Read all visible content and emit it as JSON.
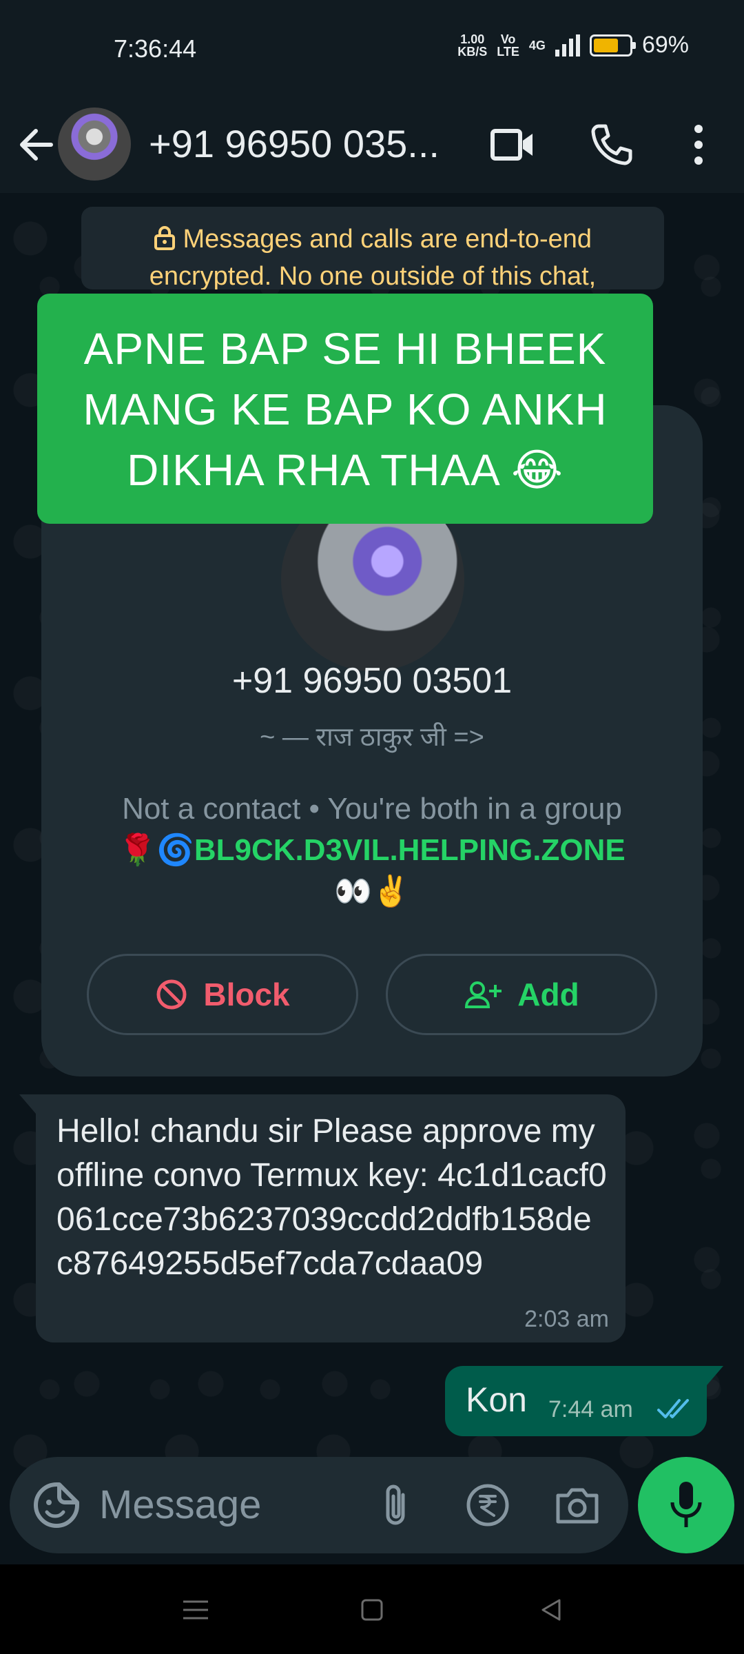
{
  "status_bar": {
    "time": "7:36:44",
    "speed_value": "1.00",
    "speed_unit": "KB/S",
    "volte_top": "Vo",
    "volte_bottom": "LTE",
    "network": "4G",
    "battery_percent": "69%",
    "battery_level": 0.69,
    "battery_color": "#f0b400"
  },
  "header": {
    "title": "+91 96950 035...",
    "icons": [
      "back-arrow-icon",
      "video-call-icon",
      "phone-icon",
      "more-options-icon"
    ]
  },
  "encryption_notice": "Messages and calls are end-to-end encrypted. No one outside of this chat,",
  "overlay_banner": {
    "text": "APNE BAP SE HI BHEEK MANG KE BAP KO ANKH DIKHA RHA THAA 😂",
    "color": "#23b14d"
  },
  "contact_card": {
    "phone": "+91 96950 03501",
    "about": "~ — राज ठाकुर जी =>",
    "info": "Not a contact • You're both in a group",
    "group_prefix": "🌹🌀",
    "group_name": "BL9CK.D3VIL.HELPING.ZONE",
    "group_suffix": "👀✌️",
    "block_label": "Block",
    "add_label": "Add"
  },
  "messages": [
    {
      "direction": "incoming",
      "text": "Hello! chandu sir Please approve my offline convo Termux key: 4c1d1cacf0061cce73b6237039ccdd2ddfb158dec87649255d5ef7cda7cdaa09",
      "time": "2:03 am"
    },
    {
      "direction": "outgoing",
      "text": "Kon",
      "time": "7:44 am",
      "status": "read"
    }
  ],
  "input_bar": {
    "placeholder": "Message",
    "icons": [
      "emoji-sticker-icon",
      "attach-icon",
      "rupee-payment-icon",
      "camera-icon",
      "mic-icon"
    ]
  },
  "colors": {
    "header_bg": "#111b21",
    "chat_bg": "#0b141a",
    "accent_green": "#25d366",
    "outgoing_bubble": "#005c4b",
    "incoming_bubble": "#202c33",
    "block_red": "#f15c6d"
  }
}
